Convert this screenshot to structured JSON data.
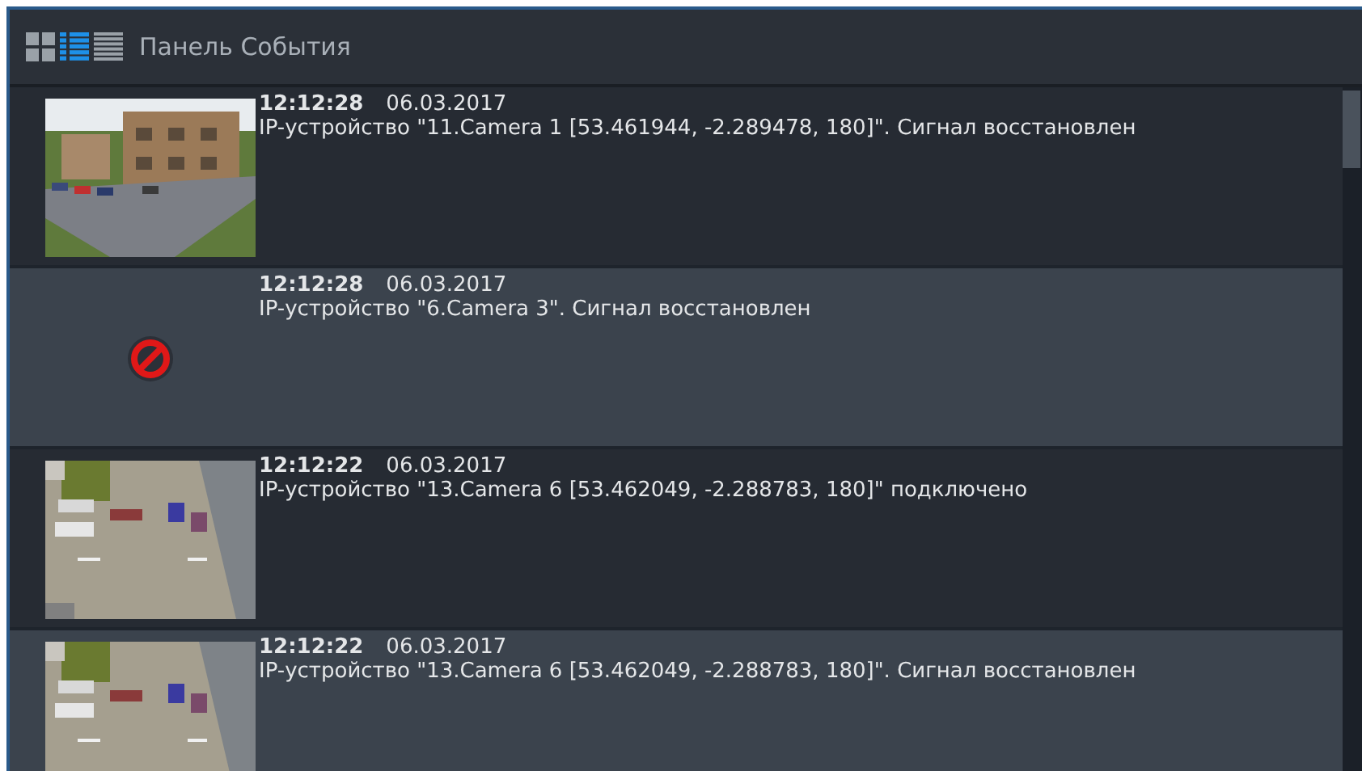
{
  "panel": {
    "title": "Панель События",
    "view_modes": [
      {
        "selected": false
      },
      {
        "selected": true
      },
      {
        "selected": false
      }
    ]
  },
  "events": [
    {
      "time": "12:12:28",
      "date": "06.03.2017",
      "message": "IP-устройство \"11.Camera 1 [53.461944, -2.289478, 180]\". Сигнал восстановлен"
    },
    {
      "time": "12:12:28",
      "date": "06.03.2017",
      "message": "IP-устройство \"6.Camera 3\". Сигнал восстановлен",
      "thumbnail": {
        "kind": "no_signal"
      }
    },
    {
      "time": "12:12:22",
      "date": "06.03.2017",
      "message": "IP-устройство \"13.Camera 6 [53.462049, -2.288783, 180]\" подключено"
    },
    {
      "time": "12:12:22",
      "date": "06.03.2017",
      "message": "IP-устройство \"13.Camera 6 [53.462049, -2.288783, 180]\". Сигнал восстановлен"
    }
  ]
}
